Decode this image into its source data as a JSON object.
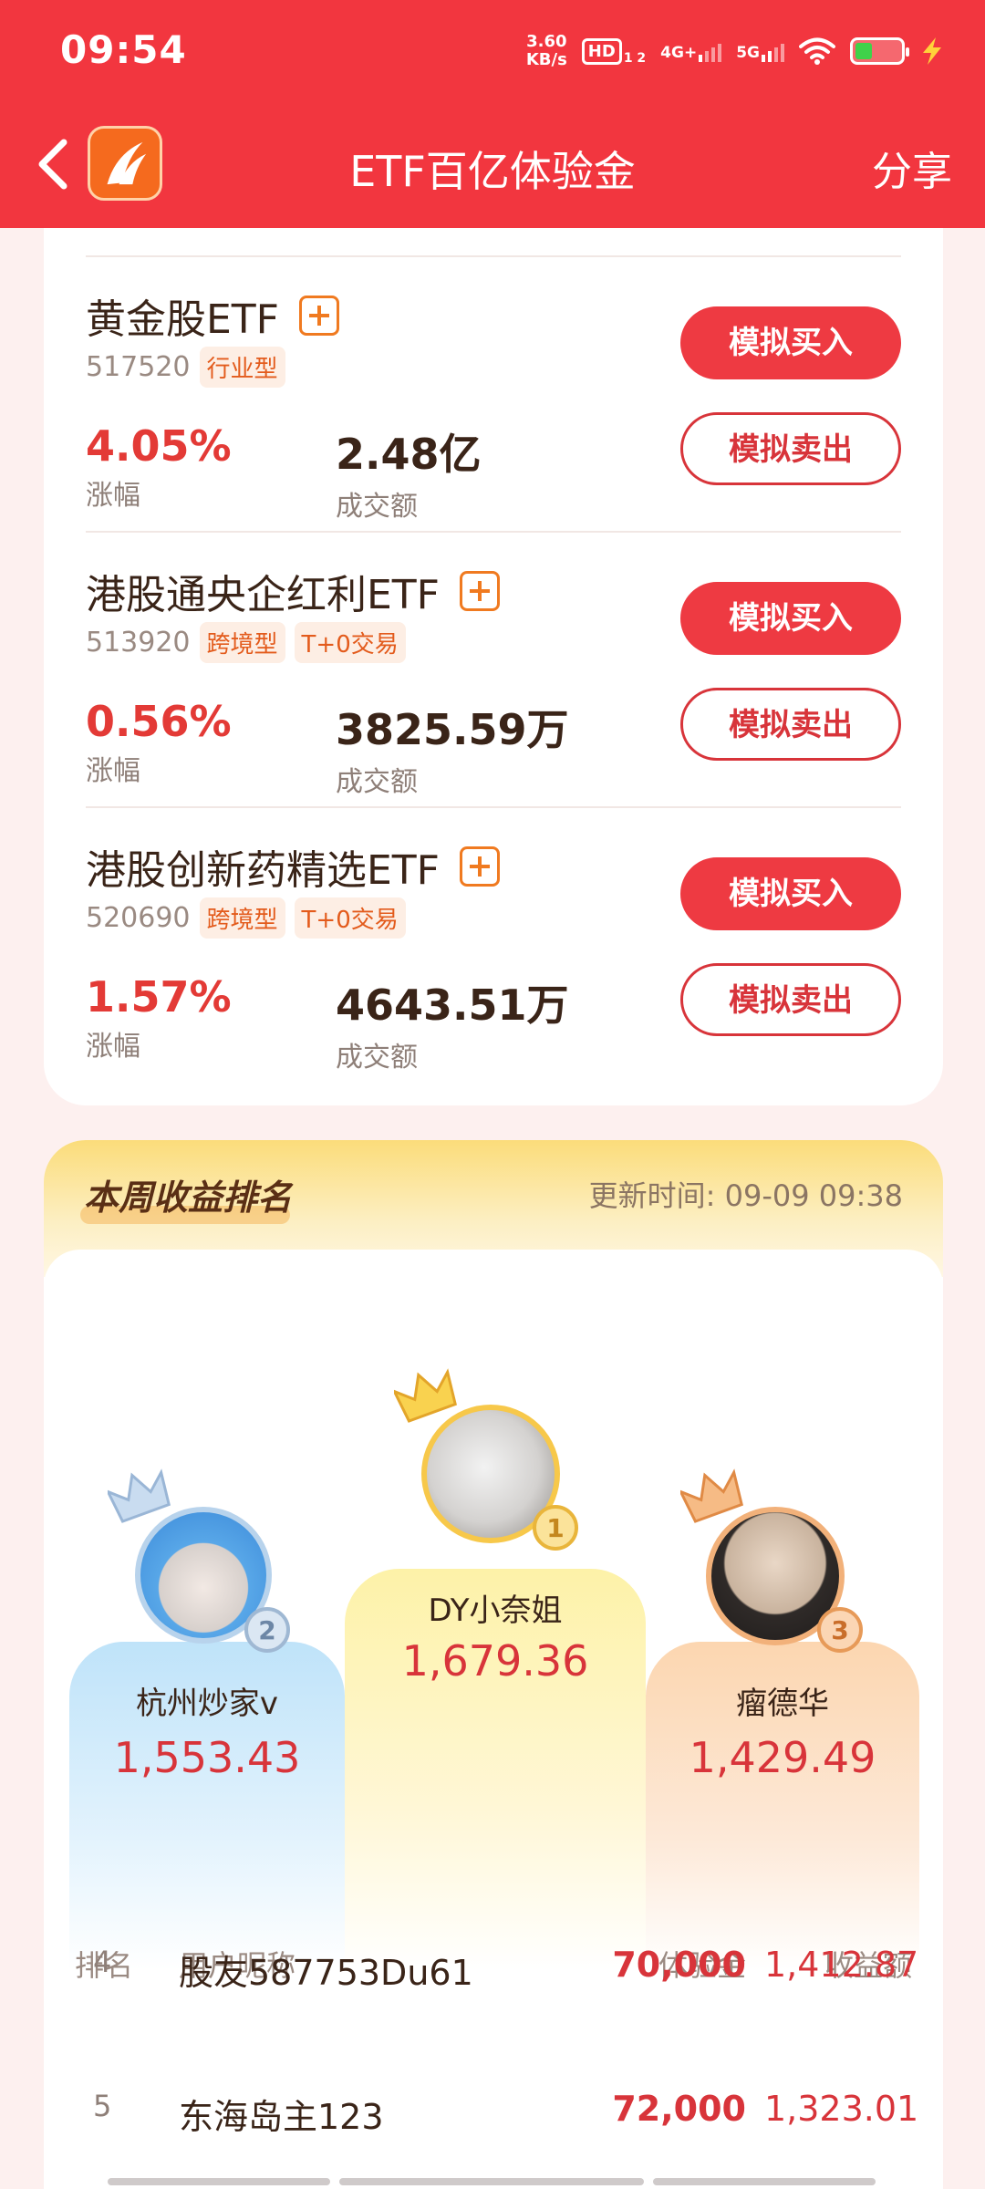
{
  "status_bar": {
    "time": "09:54",
    "net_speed_value": "3.60",
    "net_speed_unit": "KB/s",
    "hd_label": "HD",
    "hd_sub": "1 2",
    "sig1_label": "4G+",
    "sig2_label": "5G"
  },
  "header": {
    "title": "ETF百亿体验金",
    "share_label": "分享"
  },
  "etf_list": [
    {
      "name": "黄金股ETF",
      "code": "517520",
      "tags": [
        "行业型"
      ],
      "change": "4.05%",
      "change_label": "涨幅",
      "amount": "2.48亿",
      "amount_label": "成交额",
      "buy_label": "模拟买入",
      "sell_label": "模拟卖出"
    },
    {
      "name": "港股通央企红利ETF",
      "code": "513920",
      "tags": [
        "跨境型",
        "T+0交易"
      ],
      "change": "0.56%",
      "change_label": "涨幅",
      "amount": "3825.59万",
      "amount_label": "成交额",
      "buy_label": "模拟买入",
      "sell_label": "模拟卖出"
    },
    {
      "name": "港股创新药精选ETF",
      "code": "520690",
      "tags": [
        "跨境型",
        "T+0交易"
      ],
      "change": "1.57%",
      "change_label": "涨幅",
      "amount": "4643.51万",
      "amount_label": "成交额",
      "buy_label": "模拟买入",
      "sell_label": "模拟卖出"
    }
  ],
  "ranking": {
    "title": "本周收益排名",
    "update_time": "更新时间: 09-09 09:38",
    "podium": [
      {
        "rank": "1",
        "name": "DY小奈姐",
        "score": "1,679.36"
      },
      {
        "rank": "2",
        "name": "杭州炒家v",
        "score": "1,553.43"
      },
      {
        "rank": "3",
        "name": "瘤德华",
        "score": "1,429.49"
      }
    ],
    "columns": {
      "rank": "排名",
      "user": "用户昵称",
      "fund": "体验金",
      "income": "收益额"
    },
    "rows": [
      {
        "rank": "4",
        "user": "股友587753Du61",
        "fund": "70,000",
        "income": "1,412.87"
      },
      {
        "rank": "5",
        "user": "东海岛主123",
        "fund": "72,000",
        "income": "1,323.01"
      }
    ]
  },
  "colors": {
    "brand_red": "#f2363f",
    "accent_orange": "#f07a20",
    "price_red": "#d8343a"
  }
}
